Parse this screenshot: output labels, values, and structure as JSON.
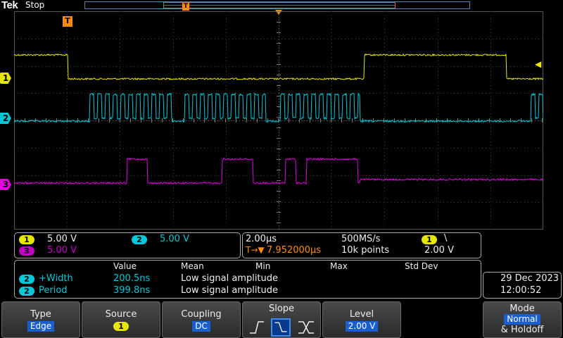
{
  "header": {
    "logo": "Tek",
    "status": "Stop",
    "trigger_badge": "T"
  },
  "channels": {
    "ch1": {
      "label": "1",
      "color": "#e6e600"
    },
    "ch2": {
      "label": "2",
      "color": "#00c8d6"
    },
    "ch3": {
      "label": "3",
      "color": "#e000e0"
    }
  },
  "trigger_marker": "T",
  "trigger_level_arrow": "◀",
  "vertical": {
    "ch1_scale": "5.00 V",
    "ch2_scale": "5.00 V",
    "ch3_scale": "5.00 V"
  },
  "horizontal": {
    "timebase": "2.00µs",
    "sample_rate": "500MS/s",
    "trigger_source": "1",
    "trigger_slope_glyph": "\\",
    "delay_icon": "T→▼",
    "delay": "7.952000µs",
    "record_length": "10k points",
    "trigger_level": "2.00 V"
  },
  "measurements": {
    "headers": [
      "Value",
      "Mean",
      "Min",
      "Max",
      "Std Dev"
    ],
    "rows": [
      {
        "source": "2",
        "name": "+Width",
        "value": "200.5ns",
        "mean": "Low signal amplitude"
      },
      {
        "source": "2",
        "name": "Period",
        "value": "399.8ns",
        "mean": "Low signal amplitude"
      }
    ]
  },
  "datetime": {
    "date": "29 Dec  2023",
    "time": "12:00:52"
  },
  "menu": {
    "type": {
      "label": "Type",
      "value": "Edge"
    },
    "source": {
      "label": "Source",
      "value": "1"
    },
    "coupling": {
      "label": "Coupling",
      "value": "DC"
    },
    "slope": {
      "label": "Slope",
      "options": [
        "rising",
        "falling",
        "either"
      ],
      "selected": "falling"
    },
    "level": {
      "label": "Level",
      "value": "2.00 V"
    },
    "mode": {
      "label": "Mode",
      "value": "Normal",
      "sub": "& Holdoff"
    }
  }
}
